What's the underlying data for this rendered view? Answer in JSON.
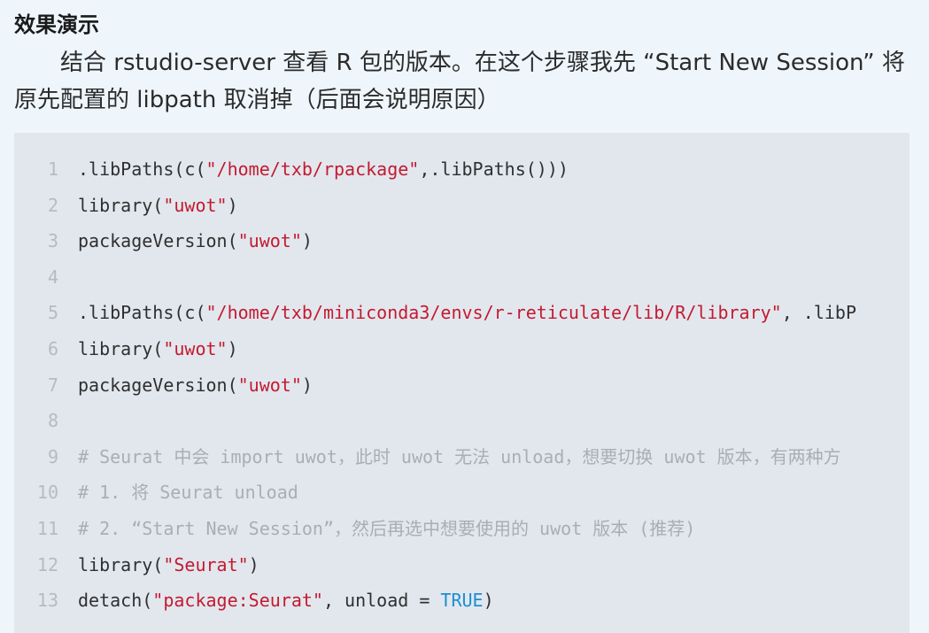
{
  "heading": "效果演示",
  "paragraph": "结合 rstudio-server 查看 R 包的版本。在这个步骤我先 “Start New Session” 将原先配置的 libpath 取消掉（后面会说明原因）",
  "code": {
    "lines": [
      {
        "number": "1",
        "tokens": [
          {
            "t": ".libPaths(c(",
            "k": "plain"
          },
          {
            "t": "\"/home/txb/rpackage\"",
            "k": "str"
          },
          {
            "t": ",.libPaths()))",
            "k": "plain"
          }
        ]
      },
      {
        "number": "2",
        "tokens": [
          {
            "t": "library(",
            "k": "plain"
          },
          {
            "t": "\"uwot\"",
            "k": "str"
          },
          {
            "t": ")",
            "k": "plain"
          }
        ]
      },
      {
        "number": "3",
        "tokens": [
          {
            "t": "packageVersion(",
            "k": "plain"
          },
          {
            "t": "\"uwot\"",
            "k": "str"
          },
          {
            "t": ")",
            "k": "plain"
          }
        ]
      },
      {
        "number": "4",
        "tokens": []
      },
      {
        "number": "5",
        "tokens": [
          {
            "t": ".libPaths(c(",
            "k": "plain"
          },
          {
            "t": "\"/home/txb/miniconda3/envs/r-reticulate/lib/R/library\"",
            "k": "str"
          },
          {
            "t": ", .libP",
            "k": "plain"
          }
        ]
      },
      {
        "number": "6",
        "tokens": [
          {
            "t": "library(",
            "k": "plain"
          },
          {
            "t": "\"uwot\"",
            "k": "str"
          },
          {
            "t": ")",
            "k": "plain"
          }
        ]
      },
      {
        "number": "7",
        "tokens": [
          {
            "t": "packageVersion(",
            "k": "plain"
          },
          {
            "t": "\"uwot\"",
            "k": "str"
          },
          {
            "t": ")",
            "k": "plain"
          }
        ]
      },
      {
        "number": "8",
        "tokens": []
      },
      {
        "number": "9",
        "tokens": [
          {
            "t": "# Seurat 中会 import uwot，此时 uwot 无法 unload，想要切换 uwot 版本，有两种方",
            "k": "cm"
          }
        ]
      },
      {
        "number": "10",
        "tokens": [
          {
            "t": "# 1. 将 Seurat unload",
            "k": "cm"
          }
        ]
      },
      {
        "number": "11",
        "tokens": [
          {
            "t": "# 2. “Start New Session”，然后再选中想要使用的 uwot 版本 (推荐)",
            "k": "cm"
          }
        ]
      },
      {
        "number": "12",
        "tokens": [
          {
            "t": "library(",
            "k": "plain"
          },
          {
            "t": "\"Seurat\"",
            "k": "str"
          },
          {
            "t": ")",
            "k": "plain"
          }
        ]
      },
      {
        "number": "13",
        "tokens": [
          {
            "t": "detach(",
            "k": "plain"
          },
          {
            "t": "\"package:Seurat\"",
            "k": "str"
          },
          {
            "t": ", unload = ",
            "k": "plain"
          },
          {
            "t": "TRUE",
            "k": "kw"
          },
          {
            "t": ")",
            "k": "plain"
          }
        ]
      }
    ]
  },
  "colors": {
    "background": "#eef6fc",
    "code_background": "#e2e7ee",
    "string": "#c41a2f",
    "keyword": "#1c8fd2",
    "comment": "#a9aeb5",
    "line_number": "#b4bbc4"
  }
}
